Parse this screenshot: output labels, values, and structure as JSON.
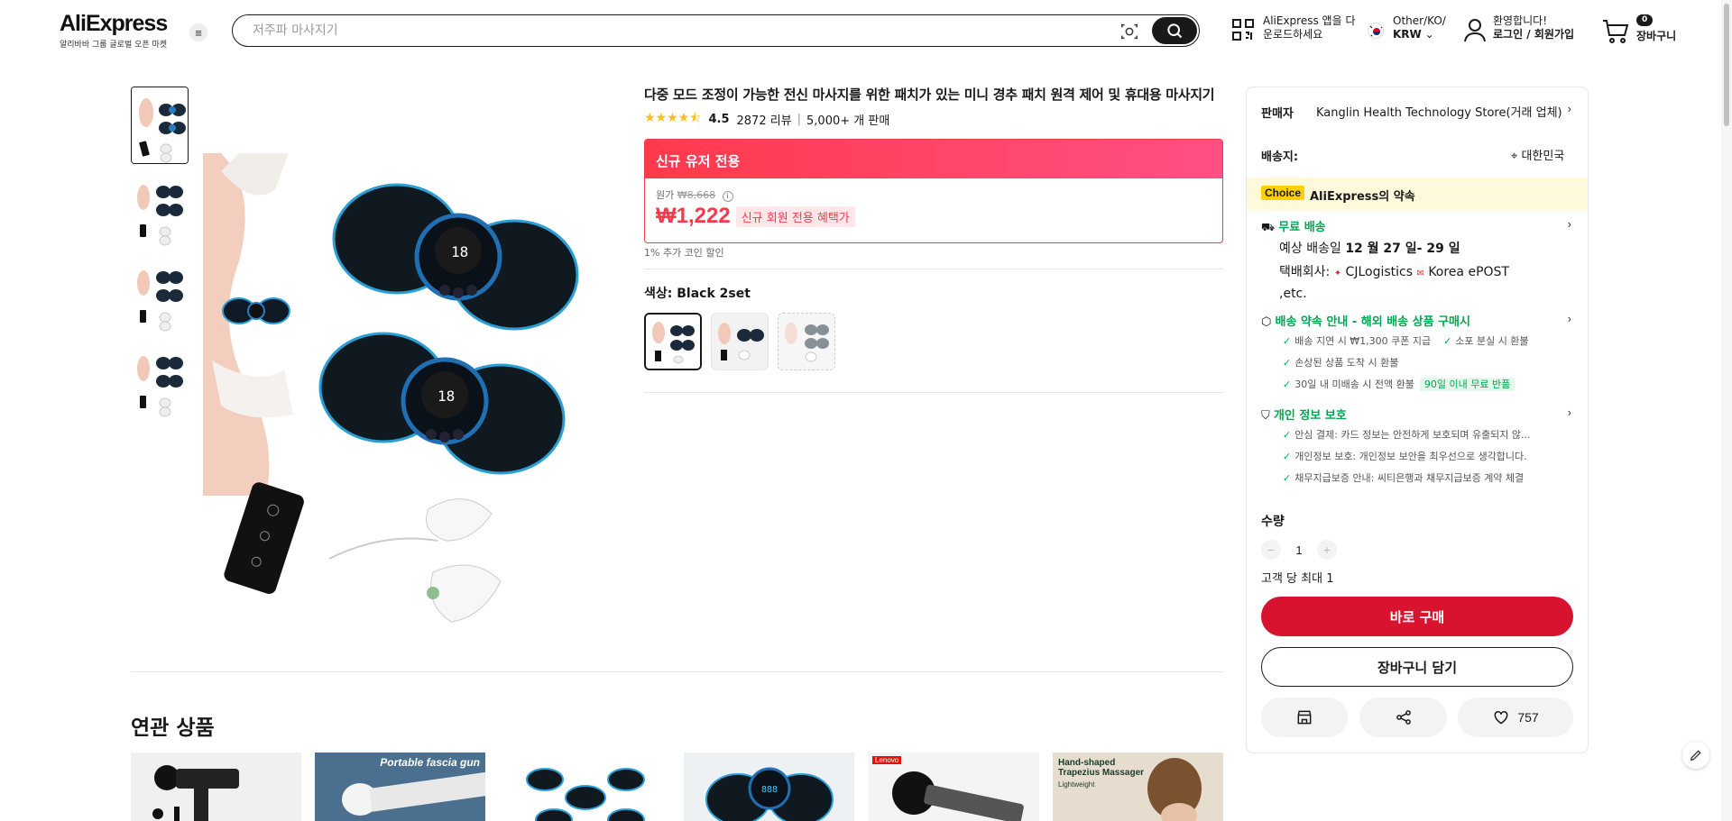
{
  "header": {
    "logo_text": "AliExpress",
    "logo_sub": "알리바바 그룹 글로벌 오픈 마켓",
    "search_placeholder": "저주파 마사지기",
    "app_line1": "AliExpress 앱을 다",
    "app_line2": "운로드하세요",
    "lang_line1": "Other/KO/",
    "lang_line2": "KRW",
    "acct_line1": "환영합니다!",
    "acct_line2": "로그인 / 회원가입",
    "cart_count": "0",
    "cart_label": "장바구니"
  },
  "product": {
    "title": "다중 모드 조정이 가능한 전신 마사지를 위한 패치가 있는 미니 경추 패치 원격 제어 및 휴대용 마사지기",
    "rating": "4.5",
    "reviews": "2872 리뷰",
    "sold": "5,000+ 개 판매",
    "promo_banner": "신규 유저 전용",
    "original_label": "원가",
    "original_price": "₩8,668",
    "price": "₩1,222",
    "new_member_tag": "신규 회원 전용 혜택가",
    "coin_note": "1% 추가 코인 할인",
    "color_label": "색상: Black 2set"
  },
  "panel": {
    "seller_label": "판매자",
    "seller_name": "Kanglin Health Technology Store(거래 업체)",
    "ship_label": "배송지:",
    "ship_country": "대한민국",
    "choice_tag": "Choice",
    "choice_text": "AliExpress의 약속",
    "free_ship": "무료 배송",
    "eta_prefix": "예상 배송일",
    "eta_dates": "12 월 27 일- 29 일",
    "courier_label": "택배회사:",
    "courier_1": "CJLogistics",
    "courier_2": "Korea",
    "courier_3": "ePOST ,etc.",
    "promise_title": "배송 약속 안내 - 해외 배송 상품 구매시",
    "promise_items": [
      "배송 지연 시 ₩1,300 쿠폰 지급",
      "소포 분실 시 환불",
      "손상된 상품 도착 시 환불",
      "30일 내 미배송 시 전액 환불"
    ],
    "promise_tag": "90일 이내 무료 반품",
    "privacy_title": "개인 정보 보호",
    "privacy_items": [
      "안심 결제: 카드 정보는 안전하게 보호되며 유출되지 않...",
      "개인정보 보호: 개인정보 보안을 최우선으로 생각합니다.",
      "채무지급보증 안내: 씨티은행과 채무지급보증 계약 체결"
    ],
    "qty_label": "수량",
    "qty_value": "1",
    "qty_limit": "고객 당 최대 1",
    "buy_now": "바로 구매",
    "add_cart": "장바구니 담기",
    "wish_count": "757"
  },
  "related": {
    "title": "연관 상품",
    "card2_text": "Portable fascia gun",
    "card5_brand": "Lenovo",
    "card6_line1": "Hand-shaped",
    "card6_line2": "Trapezius Massager",
    "card6_line3": "Lightweight"
  }
}
